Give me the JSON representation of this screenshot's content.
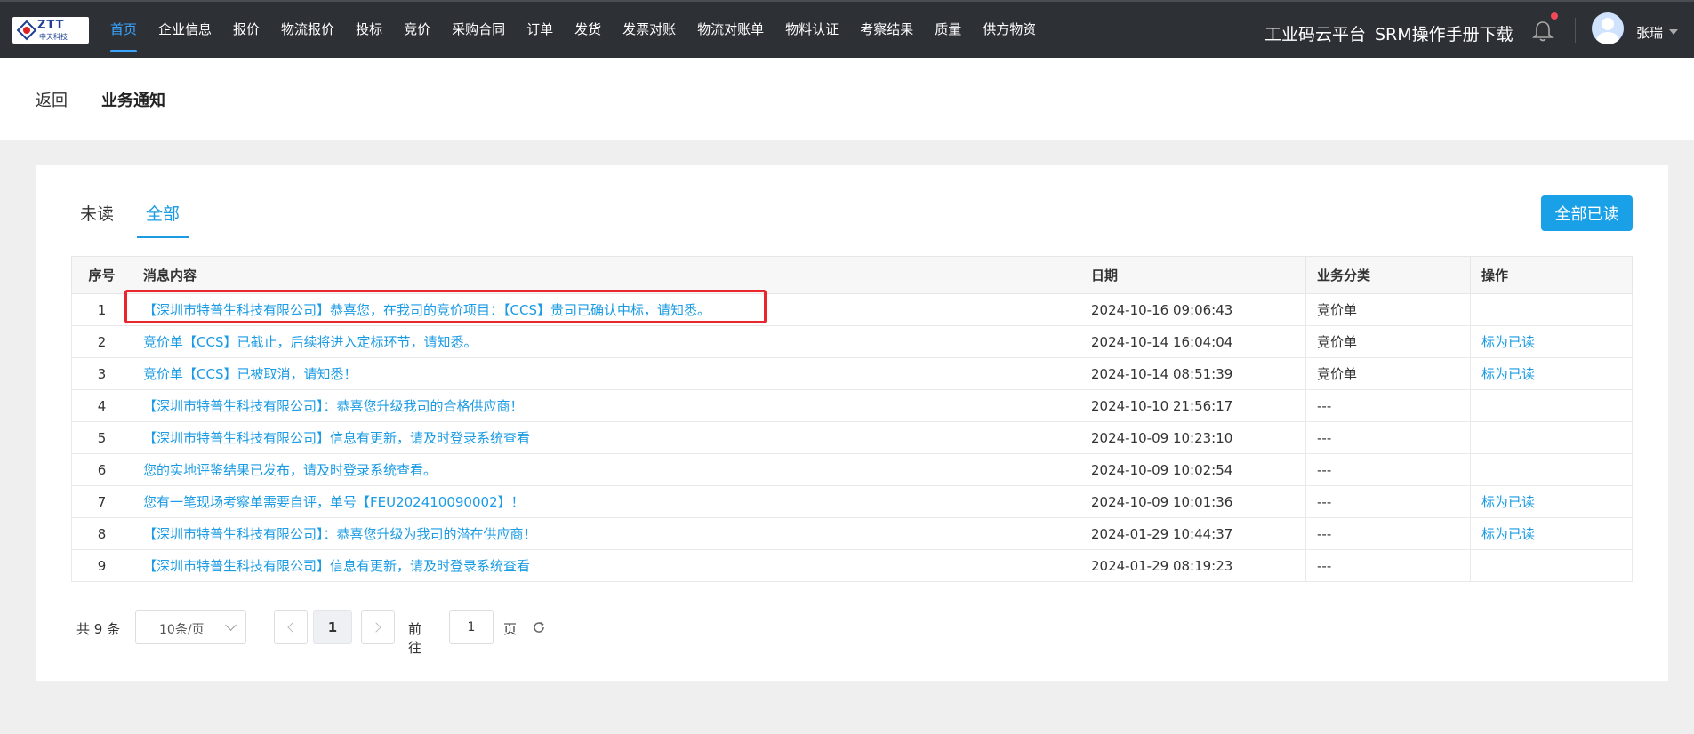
{
  "app": {
    "logo_brand": "ZTT",
    "logo_sub": "中天科技"
  },
  "nav": {
    "items": [
      {
        "label": "首页",
        "active": true
      },
      {
        "label": "企业信息"
      },
      {
        "label": "报价"
      },
      {
        "label": "物流报价"
      },
      {
        "label": "投标"
      },
      {
        "label": "竞价"
      },
      {
        "label": "采购合同"
      },
      {
        "label": "订单"
      },
      {
        "label": "发货"
      },
      {
        "label": "发票对账"
      },
      {
        "label": "物流对账单"
      },
      {
        "label": "物料认证"
      },
      {
        "label": "考察结果"
      },
      {
        "label": "质量"
      },
      {
        "label": "供方物资"
      }
    ]
  },
  "header_right": {
    "platform_link": "工业码云平台",
    "manual_link": "SRM操作手册下载",
    "username": "张瑞",
    "icons": {
      "bell": "bell-icon",
      "avatar": "avatar"
    }
  },
  "subheader": {
    "back_label": "返回",
    "title": "业务通知"
  },
  "tabs": [
    {
      "label": "未读",
      "active": false
    },
    {
      "label": "全部",
      "active": true
    }
  ],
  "actions": {
    "mark_all_read": "全部已读"
  },
  "table": {
    "headers": {
      "index": "序号",
      "message": "消息内容",
      "date": "日期",
      "category": "业务分类",
      "operation": "操作"
    },
    "rows": [
      {
        "index": "1",
        "message": "【深圳市特普生科技有限公司】恭喜您，在我司的竞价项目：【CCS】贵司已确认中标，请知悉。",
        "date": "2024-10-16 09:06:43",
        "category": "竞价单",
        "operation": ""
      },
      {
        "index": "2",
        "message": "竞价单【CCS】已截止，后续将进入定标环节，请知悉。",
        "date": "2024-10-14 16:04:04",
        "category": "竞价单",
        "operation": "标为已读"
      },
      {
        "index": "3",
        "message": "竞价单【CCS】已被取消，请知悉！",
        "date": "2024-10-14 08:51:39",
        "category": "竞价单",
        "operation": "标为已读"
      },
      {
        "index": "4",
        "message": "【深圳市特普生科技有限公司】：恭喜您升级我司的合格供应商！",
        "date": "2024-10-10 21:56:17",
        "category": "---",
        "operation": ""
      },
      {
        "index": "5",
        "message": "【深圳市特普生科技有限公司】信息有更新，请及时登录系统查看",
        "date": "2024-10-09 10:23:10",
        "category": "---",
        "operation": ""
      },
      {
        "index": "6",
        "message": "您的实地评鉴结果已发布，请及时登录系统查看。",
        "date": "2024-10-09 10:02:54",
        "category": "---",
        "operation": ""
      },
      {
        "index": "7",
        "message": "您有一笔现场考察单需要自评，单号【FEU202410090002】！",
        "date": "2024-10-09 10:01:36",
        "category": "---",
        "operation": "标为已读"
      },
      {
        "index": "8",
        "message": "【深圳市特普生科技有限公司】：恭喜您升级为我司的潜在供应商！",
        "date": "2024-01-29 10:44:37",
        "category": "---",
        "operation": "标为已读"
      },
      {
        "index": "9",
        "message": "【深圳市特普生科技有限公司】信息有更新，请及时登录系统查看",
        "date": "2024-01-29 08:19:23",
        "category": "---",
        "operation": ""
      }
    ]
  },
  "pagination": {
    "total": "共 9 条",
    "page_size": "10条/页",
    "current_page": "1",
    "goto_label": "前往",
    "goto_value": "1",
    "page_suffix": "页"
  },
  "colors": {
    "accent": "#1a9be3",
    "nav_bg": "#2d3035",
    "highlight": "#e8262b"
  }
}
